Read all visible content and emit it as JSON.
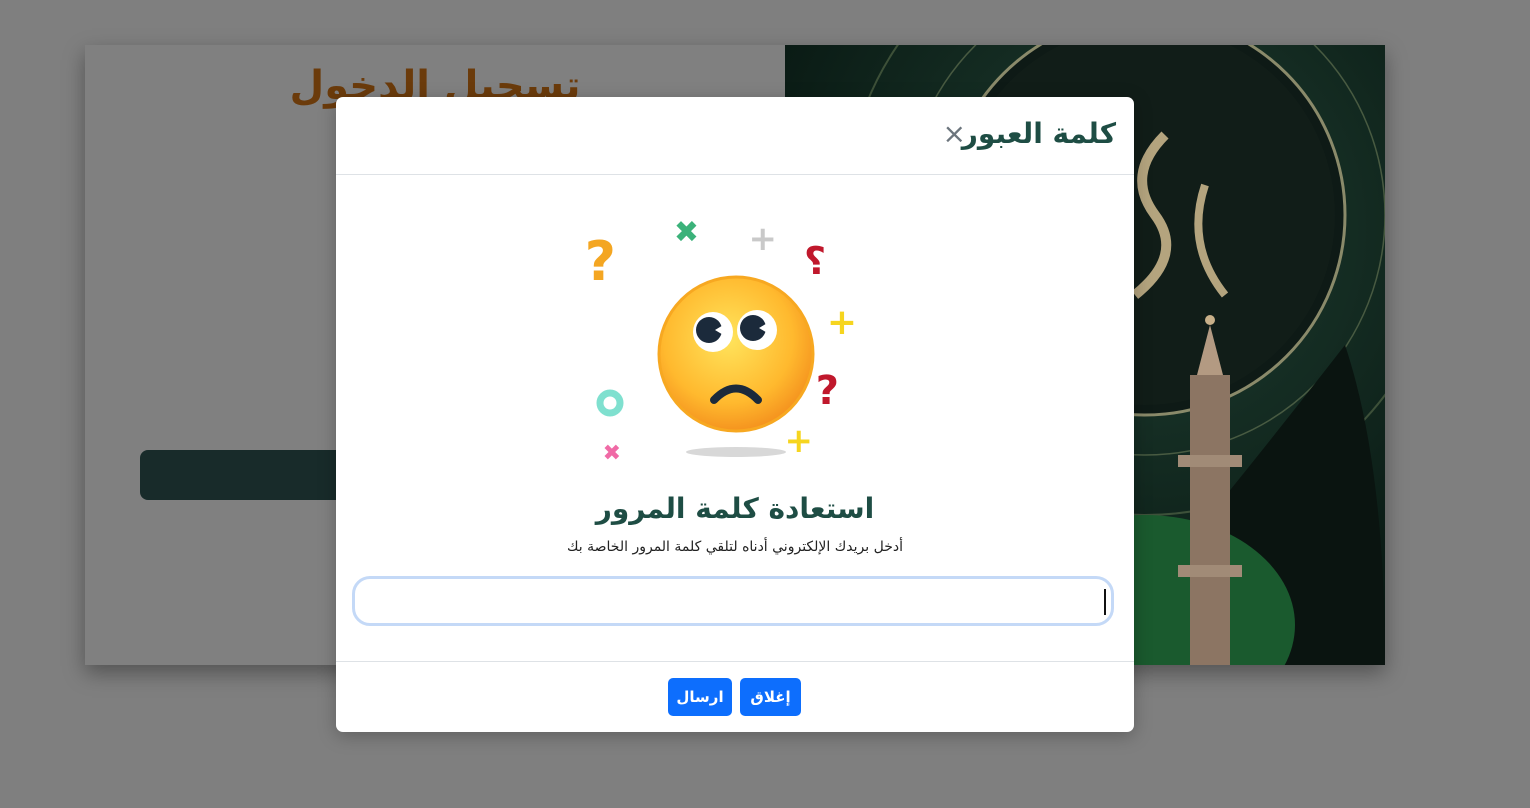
{
  "background": {
    "login_title": "تسجيل الدخول"
  },
  "modal": {
    "title": "كلمة العبور",
    "close_icon": "close-icon",
    "heading": "استعادة كلمة المرور",
    "subtitle": "أدخل بريدك الإلكتروني أدناه لتلقي كلمة المرور الخاصة بك",
    "email": {
      "value": "",
      "placeholder": ""
    },
    "buttons": {
      "close_label": "إغلاق",
      "send_label": "ارسال"
    }
  },
  "colors": {
    "primary": "#0d6efd",
    "title_green": "#1e4d44",
    "overlay": "#7f7f7f"
  }
}
